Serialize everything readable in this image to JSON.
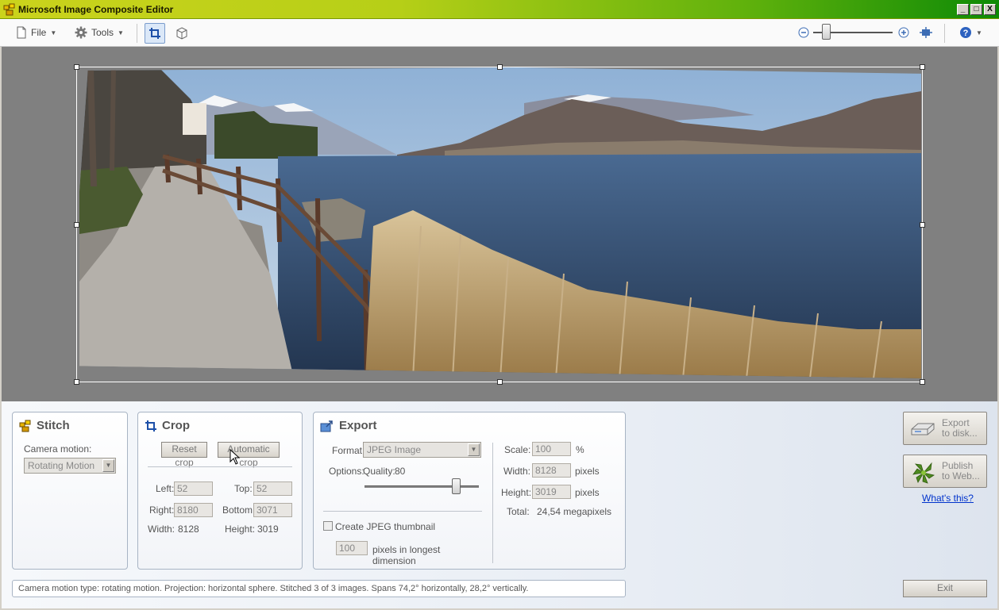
{
  "window": {
    "title": "Microsoft Image Composite Editor",
    "min": "_",
    "max": "□",
    "close": "X"
  },
  "toolbar": {
    "file_label": "File",
    "tools_label": "Tools"
  },
  "stitch": {
    "title": "Stitch",
    "camera_motion_label": "Camera motion:",
    "camera_motion_value": "Rotating Motion"
  },
  "crop": {
    "title": "Crop",
    "reset_label": "Reset crop",
    "auto_label": "Automatic crop",
    "left_label": "Left:",
    "left_value": "52",
    "top_label": "Top:",
    "top_value": "52",
    "right_label": "Right:",
    "right_value": "8180",
    "bottom_label": "Bottom:",
    "bottom_value": "3071",
    "width_label": "Width:",
    "width_value": "8128",
    "height_label": "Height:",
    "height_value": "3019"
  },
  "export": {
    "title": "Export",
    "format_label": "Format:",
    "format_value": "JPEG Image",
    "options_label": "Options:",
    "quality_label": "Quality:",
    "quality_value": "80",
    "quality_fraction": 0.8,
    "thumbnail_label": "Create JPEG thumbnail",
    "thumbnail_size": "100",
    "thumbnail_unit_1": "pixels in longest",
    "thumbnail_unit_2": "dimension",
    "scale_label": "Scale:",
    "scale_value": "100",
    "scale_unit": "%",
    "width_label": "Width:",
    "width_value": "8128",
    "width_unit": "pixels",
    "height_label": "Height:",
    "height_value": "3019",
    "height_unit": "pixels",
    "total_label": "Total:",
    "total_value": "24,54 megapixels"
  },
  "actions": {
    "export_disk_1": "Export",
    "export_disk_2": "to disk...",
    "publish_1": "Publish",
    "publish_2": "to Web...",
    "whats_this": "What's this?",
    "exit": "Exit"
  },
  "status": "Camera motion type: rotating motion. Projection: horizontal sphere. Stitched 3 of 3 images. Spans 74,2° horizontally, 28,2° vertically."
}
